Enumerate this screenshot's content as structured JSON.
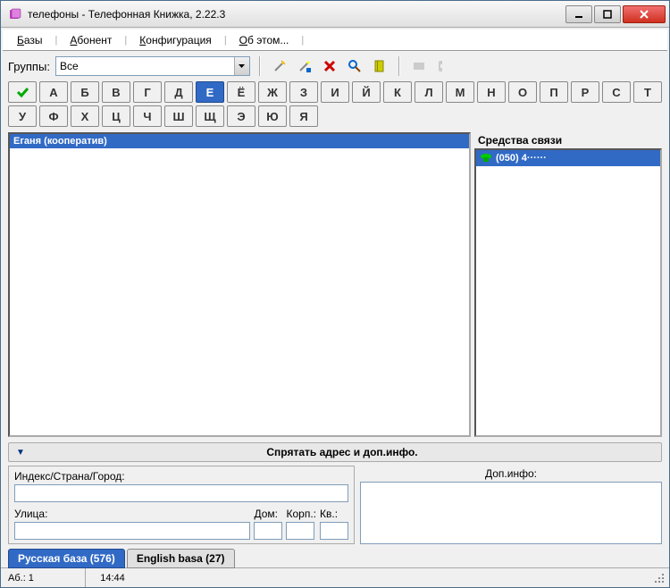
{
  "window": {
    "title": "телефоны - Телефонная Книжка, 2.22.3"
  },
  "menu": {
    "bases": "Базы",
    "subscriber": "Абонент",
    "config": "Конфигурация",
    "about": "Об этом..."
  },
  "toolbar": {
    "groups_label": "Группы:",
    "group_selected": "Все"
  },
  "alphabet": {
    "rows": [
      "А",
      "Б",
      "В",
      "Г",
      "Д",
      "Е",
      "Ё",
      "Ж",
      "З",
      "И",
      "Й",
      "К",
      "Л",
      "М",
      "Н",
      "О",
      "П",
      "Р",
      "С",
      "Т",
      "У",
      "Ф",
      "Х",
      "Ц",
      "Ч",
      "Ш",
      "Щ",
      "Э",
      "Ю",
      "Я"
    ],
    "active": "Е"
  },
  "list": {
    "selected": "Еганя (кооператив)"
  },
  "comm": {
    "header": "Средства связи",
    "phone": "(050) 4······"
  },
  "collapse": {
    "label": "Спрятать адрес и доп.инфо."
  },
  "address": {
    "index_label": "Индекс/Страна/Город:",
    "street_label": "Улица:",
    "house_label": "Дом:",
    "building_label": "Корп.:",
    "apt_label": "Кв.:",
    "index_value": "",
    "street_value": "",
    "house_value": "",
    "building_value": "",
    "apt_value": ""
  },
  "dopinfo": {
    "header": "Доп.инфо:",
    "value": ""
  },
  "tabs": {
    "tab1": "Русская база (576)",
    "tab2": "English basa (27)"
  },
  "status": {
    "count": "Аб.: 1",
    "time": "14:44"
  }
}
